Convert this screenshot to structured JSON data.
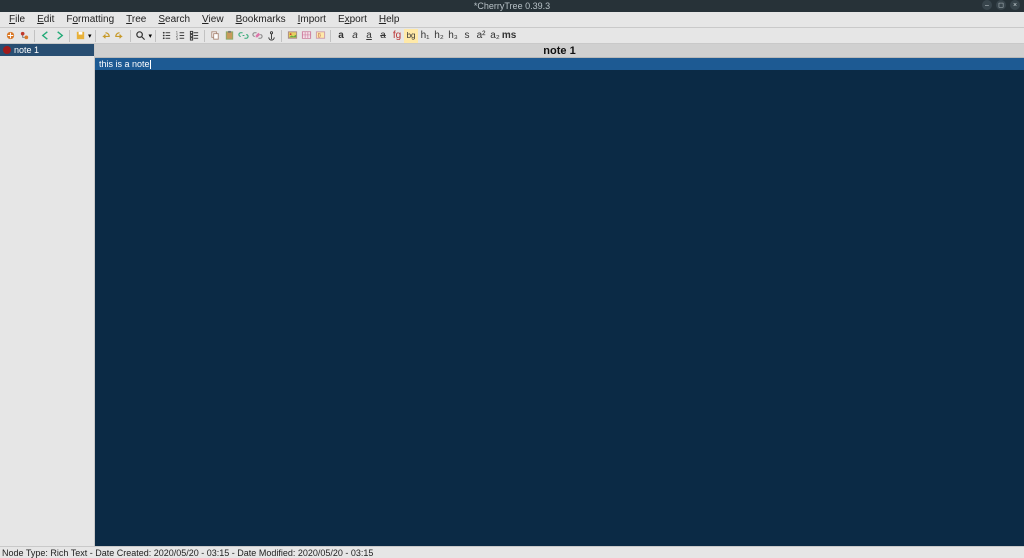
{
  "window": {
    "title": "*CherryTree 0.39.3"
  },
  "menu": {
    "items": [
      {
        "label": "File",
        "accel": "F"
      },
      {
        "label": "Edit",
        "accel": "E"
      },
      {
        "label": "Formatting",
        "accel": "o"
      },
      {
        "label": "Tree",
        "accel": "T"
      },
      {
        "label": "Search",
        "accel": "S"
      },
      {
        "label": "View",
        "accel": "V"
      },
      {
        "label": "Bookmarks",
        "accel": "B"
      },
      {
        "label": "Import",
        "accel": "I"
      },
      {
        "label": "Export",
        "accel": "x"
      },
      {
        "label": "Help",
        "accel": "H"
      }
    ]
  },
  "toolbar": {
    "icons": {
      "node_add": "add-node",
      "node_add_child": "add-child",
      "nav_back": "back",
      "nav_fwd": "forward",
      "save": "save",
      "undo": "undo",
      "redo": "redo",
      "find": "find",
      "list_bullet": "bullet-list",
      "list_number": "number-list",
      "list_todo": "todo-list",
      "copy": "copy",
      "paste": "paste",
      "link": "link",
      "link_edit": "link-edit",
      "anchor": "anchor",
      "image": "image",
      "table": "table",
      "codebox": "codebox",
      "bold": "a",
      "italic": "a",
      "underline": "a",
      "strike": "a",
      "fg": "fg",
      "bg": "bg",
      "h1": "h₁",
      "h2": "h₂",
      "h3": "h₃",
      "small": "s",
      "sup": "a²",
      "sub": "a₂",
      "mono": "ms"
    }
  },
  "tree": {
    "nodes": [
      {
        "label": "note 1"
      }
    ]
  },
  "content": {
    "header": "note 1",
    "text": "this is a note"
  },
  "status": {
    "text": "Node Type: Rich Text  -  Date Created: 2020/05/20 - 03:15  -  Date Modified: 2020/05/20 - 03:15"
  }
}
